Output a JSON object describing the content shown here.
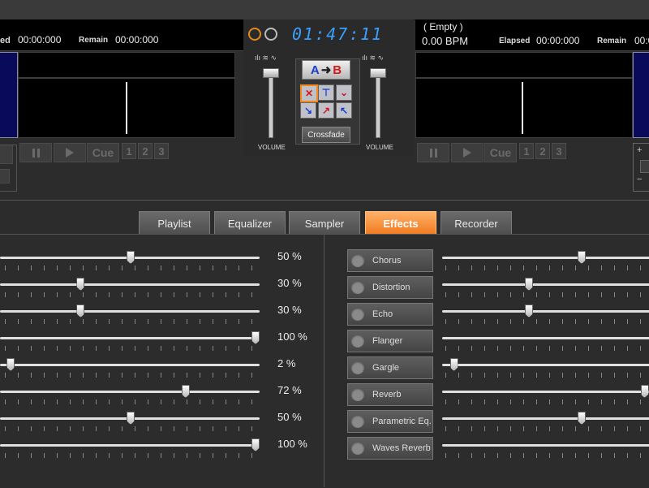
{
  "decks": {
    "left": {
      "elapsed_label": "ed",
      "elapsed": "00:00:000",
      "remain_label": "Remain",
      "remain": "00:00:000",
      "cue_label": "Cue",
      "hotcues": [
        "1",
        "2",
        "3"
      ]
    },
    "right": {
      "title": "( Empty )",
      "bpm": "0.00 BPM",
      "elapsed_label": "Elapsed",
      "elapsed": "00:00:000",
      "remain_label": "Remain",
      "remain": "00:00:0",
      "cue_label": "Cue",
      "hotcues": [
        "1",
        "2",
        "3"
      ]
    }
  },
  "mixer": {
    "clock": "01:47:11",
    "volume_label_left": "VOLUME",
    "volume_label_right": "VOLUME",
    "ab_a": "A",
    "ab_b": "B",
    "crossfade_label": "Crossfade"
  },
  "tabs": [
    "Playlist",
    "Equalizer",
    "Sampler",
    "Effects",
    "Recorder"
  ],
  "active_tab": "Effects",
  "effects": {
    "left_params": [
      {
        "percent_label": "50 %",
        "value": 0.5
      },
      {
        "percent_label": "30 %",
        "value": 0.3
      },
      {
        "percent_label": "30 %",
        "value": 0.3
      },
      {
        "percent_label": "100 %",
        "value": 1.0
      },
      {
        "percent_label": "2 %",
        "value": 0.02
      },
      {
        "percent_label": "72 %",
        "value": 0.72
      },
      {
        "percent_label": "50 %",
        "value": 0.5
      },
      {
        "percent_label": "100 %",
        "value": 1.0
      }
    ],
    "fx_list": [
      {
        "label": "Chorus",
        "level": 0.66
      },
      {
        "label": "Distortion",
        "level": 0.4
      },
      {
        "label": "Echo",
        "level": 0.4
      },
      {
        "label": "Flanger",
        "level": null
      },
      {
        "label": "Gargle",
        "level": 0.03
      },
      {
        "label": "Reverb",
        "level": 0.97
      },
      {
        "label": "Parametric Eq.",
        "level": 0.66
      },
      {
        "label": "Waves Reverb",
        "level": null
      }
    ]
  },
  "colors": {
    "accent": "#f07a1e",
    "clock": "#3aa0ff",
    "panel_blue": "#0a0a5a"
  }
}
